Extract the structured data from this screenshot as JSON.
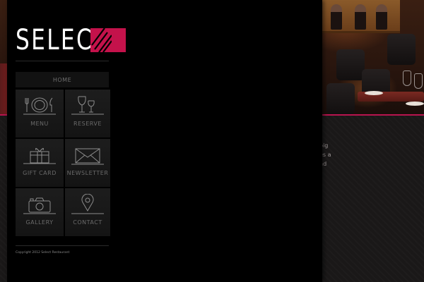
{
  "brand": {
    "logo_text": "SELECT",
    "accent_color": "#c4124b"
  },
  "nav": {
    "home_label": "HOME",
    "tiles": [
      {
        "label": "MENU",
        "icon": "plate-cutlery-icon"
      },
      {
        "label": "RESERVE",
        "icon": "wine-glasses-icon"
      },
      {
        "label": "GIFT CARD",
        "icon": "gift-box-icon"
      },
      {
        "label": "NEWSLETTER",
        "icon": "envelope-icon"
      },
      {
        "label": "GALLERY",
        "icon": "camera-icon"
      },
      {
        "label": "CONTACT",
        "icon": "map-pin-icon"
      }
    ]
  },
  "content": {
    "text_lines": [
      "big",
      "es a",
      "nd"
    ]
  },
  "footer": {
    "copyright": "Copyright 2012 Select Restaurant"
  }
}
